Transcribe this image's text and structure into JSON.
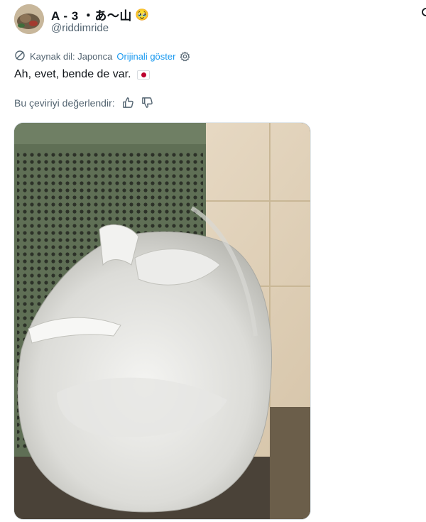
{
  "author": {
    "display_name": "A - 3 ・あ〜山",
    "emoji": "🥹",
    "handle": "@riddimride"
  },
  "translation": {
    "source_label": "Kaynak dil: Japonca",
    "show_original": "Orijinali göster"
  },
  "tweet": {
    "text": "Ah, evet, bende de var."
  },
  "rating": {
    "prompt": "Bu çeviriyi değerlendir:"
  },
  "icons": {
    "translate": "translate-icon",
    "settings": "gear-icon",
    "thumbs_up": "thumbs-up-icon",
    "thumbs_down": "thumbs-down-icon",
    "flag": "japan-flag-icon"
  },
  "colors": {
    "link": "#1d9bf0",
    "secondary_text": "#536471",
    "primary_text": "#0f1419",
    "flag_red": "#bc002d"
  }
}
